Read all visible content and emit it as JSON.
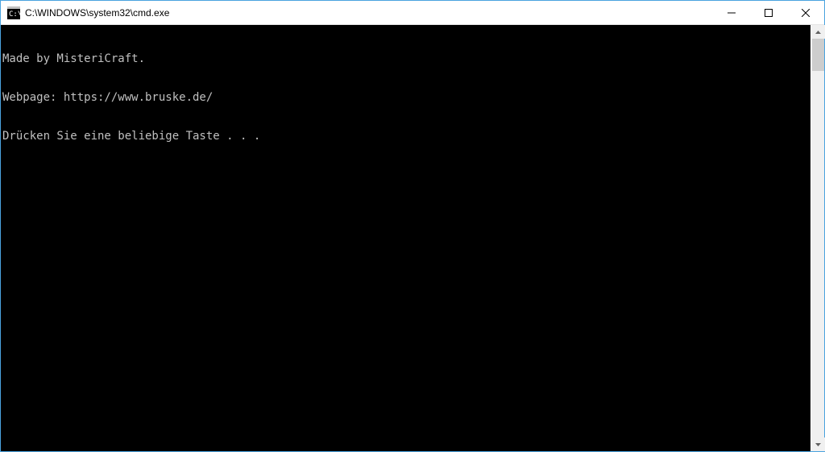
{
  "window": {
    "title": "C:\\WINDOWS\\system32\\cmd.exe"
  },
  "console": {
    "lines": [
      "Made by MisteriCraft.",
      "Webpage: https://www.bruske.de/",
      "Drücken Sie eine beliebige Taste . . ."
    ]
  }
}
